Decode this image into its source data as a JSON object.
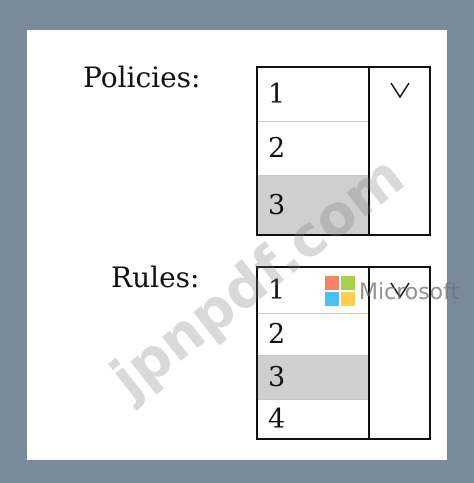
{
  "policies": {
    "label": "Policies:",
    "options": [
      "1",
      "2",
      "3"
    ],
    "selected_index": 2,
    "arrow_glyph": "V"
  },
  "rules": {
    "label": "Rules:",
    "options": [
      "1",
      "2",
      "3",
      "4"
    ],
    "selected_index": 2,
    "arrow_glyph": "V"
  },
  "watermark": {
    "text": "jpnpdf.com",
    "brand_text": "Microsoft",
    "logo_colors": [
      "#f25022",
      "#7fba00",
      "#00a4ef",
      "#ffb900"
    ]
  },
  "colors": {
    "frame": "#7a8a9b",
    "panel": "#ffffff",
    "selected_option": "#cfcfcf",
    "border": "#111111"
  }
}
